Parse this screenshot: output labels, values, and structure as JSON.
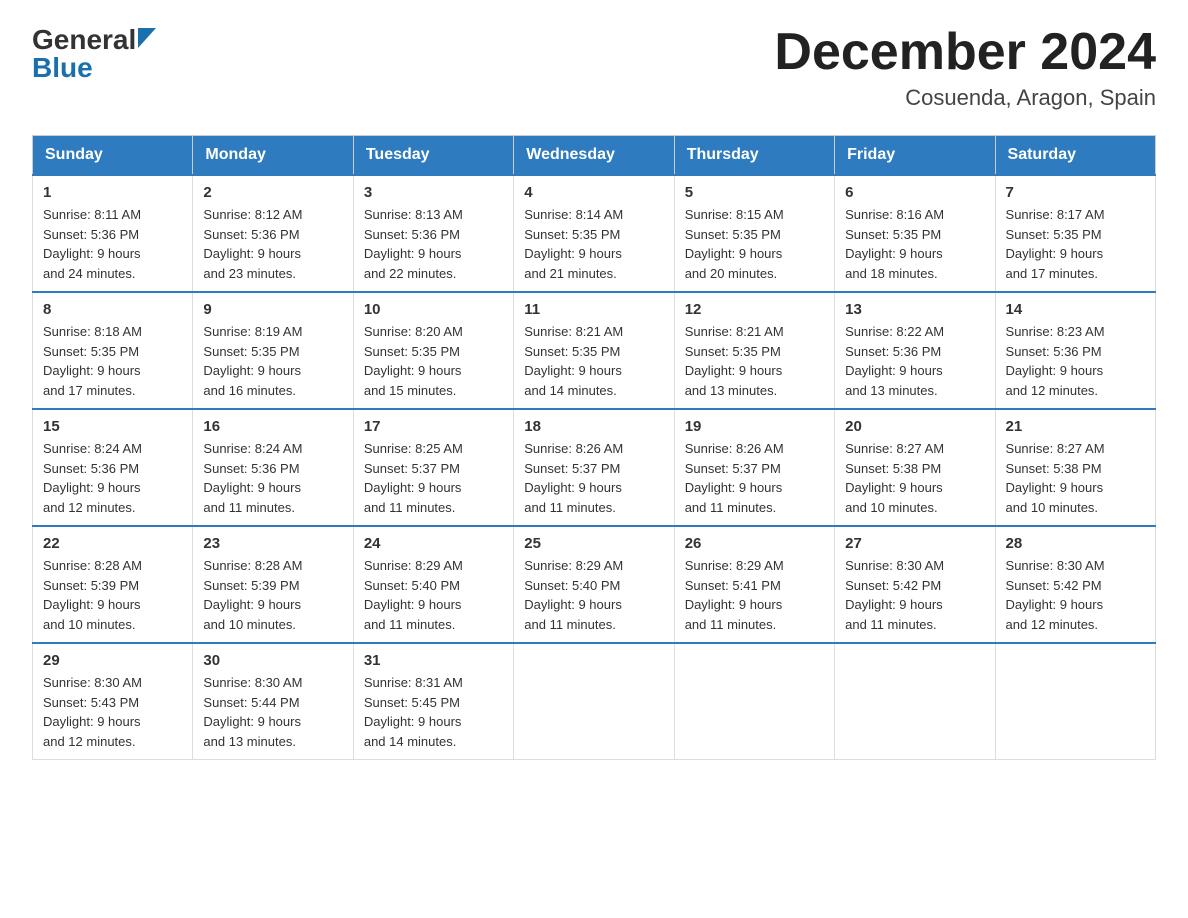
{
  "header": {
    "logo_general": "General",
    "logo_blue": "Blue",
    "month_title": "December 2024",
    "location": "Cosuenda, Aragon, Spain"
  },
  "days_of_week": [
    "Sunday",
    "Monday",
    "Tuesday",
    "Wednesday",
    "Thursday",
    "Friday",
    "Saturday"
  ],
  "weeks": [
    [
      {
        "num": "1",
        "sunrise": "8:11 AM",
        "sunset": "5:36 PM",
        "daylight": "9 hours and 24 minutes."
      },
      {
        "num": "2",
        "sunrise": "8:12 AM",
        "sunset": "5:36 PM",
        "daylight": "9 hours and 23 minutes."
      },
      {
        "num": "3",
        "sunrise": "8:13 AM",
        "sunset": "5:36 PM",
        "daylight": "9 hours and 22 minutes."
      },
      {
        "num": "4",
        "sunrise": "8:14 AM",
        "sunset": "5:35 PM",
        "daylight": "9 hours and 21 minutes."
      },
      {
        "num": "5",
        "sunrise": "8:15 AM",
        "sunset": "5:35 PM",
        "daylight": "9 hours and 20 minutes."
      },
      {
        "num": "6",
        "sunrise": "8:16 AM",
        "sunset": "5:35 PM",
        "daylight": "9 hours and 18 minutes."
      },
      {
        "num": "7",
        "sunrise": "8:17 AM",
        "sunset": "5:35 PM",
        "daylight": "9 hours and 17 minutes."
      }
    ],
    [
      {
        "num": "8",
        "sunrise": "8:18 AM",
        "sunset": "5:35 PM",
        "daylight": "9 hours and 17 minutes."
      },
      {
        "num": "9",
        "sunrise": "8:19 AM",
        "sunset": "5:35 PM",
        "daylight": "9 hours and 16 minutes."
      },
      {
        "num": "10",
        "sunrise": "8:20 AM",
        "sunset": "5:35 PM",
        "daylight": "9 hours and 15 minutes."
      },
      {
        "num": "11",
        "sunrise": "8:21 AM",
        "sunset": "5:35 PM",
        "daylight": "9 hours and 14 minutes."
      },
      {
        "num": "12",
        "sunrise": "8:21 AM",
        "sunset": "5:35 PM",
        "daylight": "9 hours and 13 minutes."
      },
      {
        "num": "13",
        "sunrise": "8:22 AM",
        "sunset": "5:36 PM",
        "daylight": "9 hours and 13 minutes."
      },
      {
        "num": "14",
        "sunrise": "8:23 AM",
        "sunset": "5:36 PM",
        "daylight": "9 hours and 12 minutes."
      }
    ],
    [
      {
        "num": "15",
        "sunrise": "8:24 AM",
        "sunset": "5:36 PM",
        "daylight": "9 hours and 12 minutes."
      },
      {
        "num": "16",
        "sunrise": "8:24 AM",
        "sunset": "5:36 PM",
        "daylight": "9 hours and 11 minutes."
      },
      {
        "num": "17",
        "sunrise": "8:25 AM",
        "sunset": "5:37 PM",
        "daylight": "9 hours and 11 minutes."
      },
      {
        "num": "18",
        "sunrise": "8:26 AM",
        "sunset": "5:37 PM",
        "daylight": "9 hours and 11 minutes."
      },
      {
        "num": "19",
        "sunrise": "8:26 AM",
        "sunset": "5:37 PM",
        "daylight": "9 hours and 11 minutes."
      },
      {
        "num": "20",
        "sunrise": "8:27 AM",
        "sunset": "5:38 PM",
        "daylight": "9 hours and 10 minutes."
      },
      {
        "num": "21",
        "sunrise": "8:27 AM",
        "sunset": "5:38 PM",
        "daylight": "9 hours and 10 minutes."
      }
    ],
    [
      {
        "num": "22",
        "sunrise": "8:28 AM",
        "sunset": "5:39 PM",
        "daylight": "9 hours and 10 minutes."
      },
      {
        "num": "23",
        "sunrise": "8:28 AM",
        "sunset": "5:39 PM",
        "daylight": "9 hours and 10 minutes."
      },
      {
        "num": "24",
        "sunrise": "8:29 AM",
        "sunset": "5:40 PM",
        "daylight": "9 hours and 11 minutes."
      },
      {
        "num": "25",
        "sunrise": "8:29 AM",
        "sunset": "5:40 PM",
        "daylight": "9 hours and 11 minutes."
      },
      {
        "num": "26",
        "sunrise": "8:29 AM",
        "sunset": "5:41 PM",
        "daylight": "9 hours and 11 minutes."
      },
      {
        "num": "27",
        "sunrise": "8:30 AM",
        "sunset": "5:42 PM",
        "daylight": "9 hours and 11 minutes."
      },
      {
        "num": "28",
        "sunrise": "8:30 AM",
        "sunset": "5:42 PM",
        "daylight": "9 hours and 12 minutes."
      }
    ],
    [
      {
        "num": "29",
        "sunrise": "8:30 AM",
        "sunset": "5:43 PM",
        "daylight": "9 hours and 12 minutes."
      },
      {
        "num": "30",
        "sunrise": "8:30 AM",
        "sunset": "5:44 PM",
        "daylight": "9 hours and 13 minutes."
      },
      {
        "num": "31",
        "sunrise": "8:31 AM",
        "sunset": "5:45 PM",
        "daylight": "9 hours and 14 minutes."
      },
      null,
      null,
      null,
      null
    ]
  ],
  "sunrise_label": "Sunrise:",
  "sunset_label": "Sunset:",
  "daylight_label": "Daylight:"
}
